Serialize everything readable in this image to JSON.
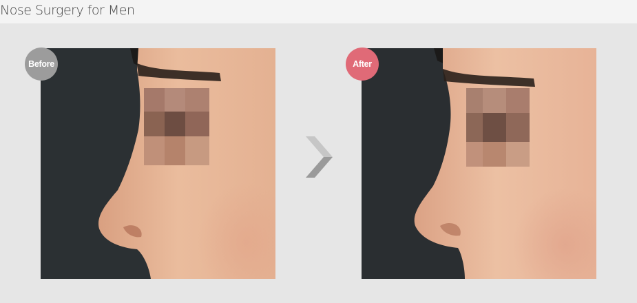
{
  "page": {
    "title": "Nose Surgery for Men"
  },
  "before": {
    "label": "Before",
    "photo_icon": "profile-before-photo"
  },
  "after": {
    "label": "After",
    "photo_icon": "profile-after-photo"
  },
  "arrow": {
    "icon": "chevron-right-icon"
  },
  "colors": {
    "page_bg": "#e6e6e6",
    "title_bar_bg": "#f4f4f4",
    "photo_bg": "#2a2e31",
    "skin": "#e7b696",
    "before_badge": "#9c9c9c",
    "after_badge": "#e06a77",
    "arrow": "#a9a9a9"
  }
}
